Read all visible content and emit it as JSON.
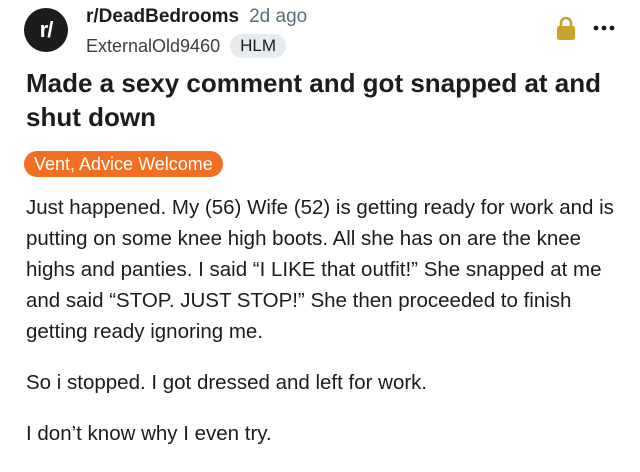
{
  "header": {
    "avatar_text": "r/",
    "subreddit": "r/DeadBedrooms",
    "time_ago": "2d ago",
    "username": "ExternalOld9460",
    "user_flair": "HLM",
    "lock_icon": "lock-icon",
    "more_icon": "more-options-icon"
  },
  "post": {
    "title": "Made a sexy comment and got snapped at and shut down",
    "flair": "Vent, Advice Welcome",
    "flair_color": "#f26f21",
    "paragraphs": [
      "Just happened. My (56) Wife (52) is getting ready for work and is putting on some knee high boots. All she has on are the knee highs and panties. I said “I LIKE that outfit!” She snapped at me and said “STOP. JUST STOP!” She then proceeded to finish getting ready ignoring me.",
      "So i stopped. I got dressed and left for work.",
      "I don’t know why I even try."
    ]
  },
  "colors": {
    "lock": "#c9a227",
    "text": "#1c1c1c",
    "muted": "#576f76"
  }
}
